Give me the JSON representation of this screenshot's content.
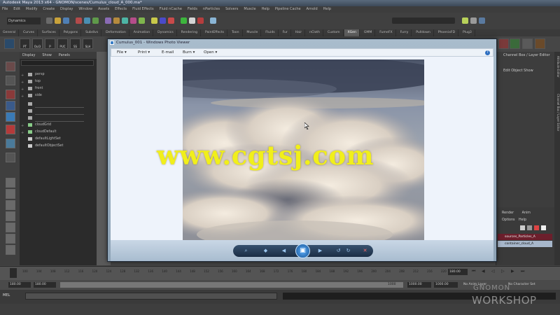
{
  "maya": {
    "title": "Autodesk Maya 2013 x64 - GNOMON/scenes/Cumulus_cloud_A_000.ma*",
    "menus": [
      "File",
      "Edit",
      "Modify",
      "Create",
      "Display",
      "Window",
      "Assets",
      "Effects",
      "Fluid Effects",
      "Fluid nCache",
      "Fields",
      "nParticles",
      "Solvers",
      "Muscle",
      "Help",
      "Pipeline Cache",
      "Arnold",
      "Help"
    ],
    "mode": "Dynamics",
    "shelf_tabs": [
      "General",
      "Curves",
      "Surfaces",
      "Polygons",
      "Subdivs",
      "Deformation",
      "Animation",
      "Dynamics",
      "Rendering",
      "PaintEffects",
      "Toon",
      "Muscle",
      "Fluids",
      "Fur",
      "Hair",
      "nCloth",
      "Custom",
      "XGen",
      "GMM",
      "FumeFX",
      "Furry",
      "Pulldown",
      "PhoenixFD",
      "Plug3"
    ],
    "shelf_icons": [
      "PT",
      "Oul3",
      "P",
      "PUC",
      "SS",
      "SLH"
    ],
    "outliner": {
      "menus": [
        "Display",
        "Show",
        "Panels"
      ],
      "items": [
        "persp",
        "top",
        "front",
        "side",
        "",
        "",
        "",
        "cloudGrid",
        "cloudDefault",
        "defaultLightSet",
        "defaultObjectSet"
      ]
    },
    "right_panel": {
      "tab": "Channel Box / Layer Editor",
      "edit_menus": [
        "Edit",
        "Object",
        "Show"
      ],
      "side_tabs": [
        "Attribute Editor",
        "Channel Box / Layer Editor"
      ],
      "layer_tabs": [
        "Render",
        "Anim"
      ],
      "layer_menus": [
        "Options",
        "Help"
      ],
      "layers": [
        "sources_Particles_A",
        "container_cloud_A"
      ]
    },
    "timeslider": {
      "ticks": [
        "100",
        "104",
        "108",
        "112",
        "116",
        "120",
        "124",
        "128",
        "132",
        "136",
        "140",
        "144",
        "148",
        "152",
        "156",
        "160",
        "164",
        "168",
        "172",
        "176",
        "180",
        "184",
        "188",
        "192",
        "196",
        "200",
        "204",
        "208",
        "212",
        "216",
        "220"
      ],
      "current_frame": "180.00"
    },
    "range": {
      "start": "180.00",
      "anim_start": "180.00",
      "playback_end": "1000",
      "anim_end": "1000.00",
      "end": "1000.00",
      "anim_layer": "No Anim Layer",
      "character": "No Character Set"
    },
    "cmd_label": "MEL"
  },
  "photo_viewer": {
    "title": "Cumulus_001 - Windows Photo Viewer",
    "menus": [
      "File",
      "Print",
      "E-mail",
      "Burn",
      "Open"
    ],
    "help": "?"
  },
  "watermark": {
    "url": "www.cgtsj.com",
    "brand_top": "GNOMON",
    "brand_bottom": "WORKSHOP"
  },
  "colors": {
    "maya_bg": "#444444",
    "viewer_frame": "#a9bccc",
    "watermark_yellow": "#f1ef1b",
    "layer_highlight": "#6c1f2c"
  }
}
